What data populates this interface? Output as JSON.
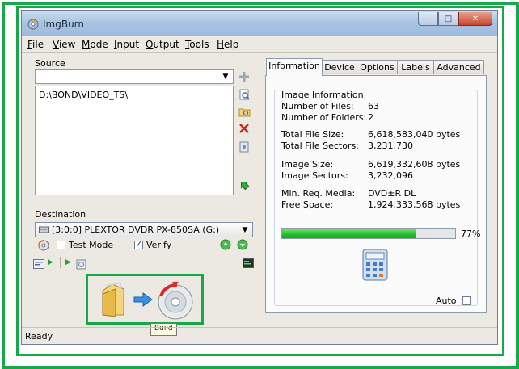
{
  "window": {
    "title": "ImgBurn"
  },
  "title_buttons": {
    "minimize": "—",
    "maximize": "□",
    "close": "✕"
  },
  "menu": [
    "File",
    "View",
    "Mode",
    "Input",
    "Output",
    "Tools",
    "Help"
  ],
  "source": {
    "label": "Source",
    "combo_value": "",
    "path": "D:\\BOND\\VIDEO_TS\\"
  },
  "destination": {
    "label": "Destination",
    "drive": "[3:0:0] PLEXTOR DVDR   PX-850SA (G:)",
    "test_mode_label": "Test Mode",
    "test_mode_checked": false,
    "verify_label": "Verify",
    "verify_checked": true
  },
  "build": {
    "tooltip": "Build"
  },
  "status": {
    "text": "Ready"
  },
  "tabs": [
    "Information",
    "Device",
    "Options",
    "Labels",
    "Advanced"
  ],
  "info": {
    "group_title": "Image Information",
    "rows": [
      {
        "label": "Number of Files:",
        "value": "63"
      },
      {
        "label": "Number of Folders:",
        "value": "2"
      },
      {
        "label": "Total File Size:",
        "value": "6,618,583,040 bytes"
      },
      {
        "label": "Total File Sectors:",
        "value": "3,231,730"
      },
      {
        "label": "Image Size:",
        "value": "6,619,332,608 bytes"
      },
      {
        "label": "Image Sectors:",
        "value": "3,232,096"
      },
      {
        "label": "Min. Req. Media:",
        "value": "DVD±R DL"
      },
      {
        "label": "Free Space:",
        "value": "1,924,333,568 bytes"
      }
    ],
    "progress_percent": 77,
    "progress_label": "77%",
    "auto_label": "Auto",
    "auto_checked": false
  },
  "colors": {
    "highlight": "#17a84a",
    "progress": "#25c52a"
  }
}
